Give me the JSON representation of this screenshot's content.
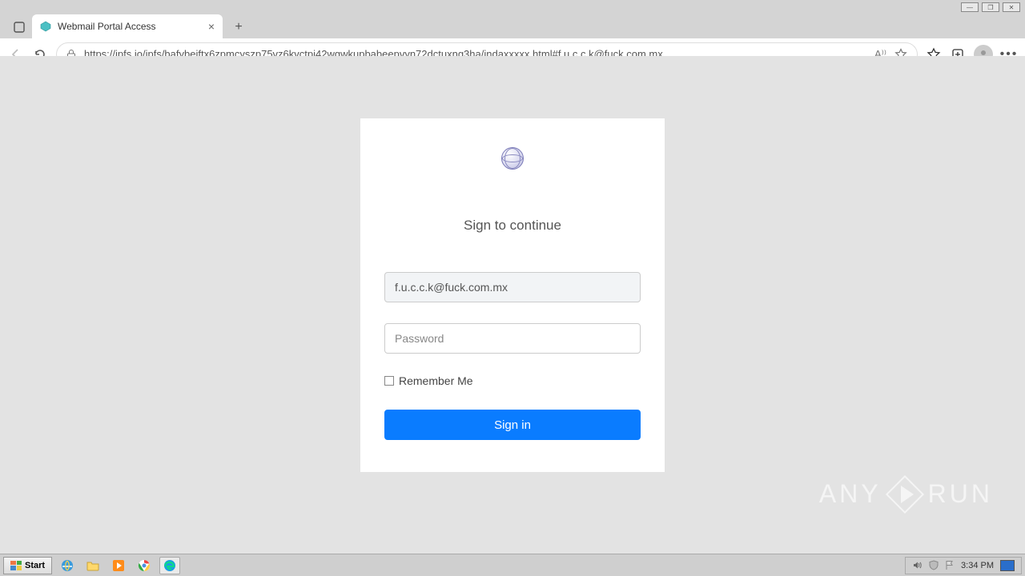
{
  "window": {
    "tab_title": "Webmail Portal Access",
    "url": "https://ipfs.io/ipfs/bafybeiftx6zpmcyszp75vz6kvctpj42wgwkupbabeepvyn72dctuxng3ha/indaxxxxx.html#f.u.c.c.k@fuck.com.mx"
  },
  "login": {
    "heading": "Sign to continue",
    "email_value": "f.u.c.c.k@fuck.com.mx",
    "password_placeholder": "Password",
    "remember_label": "Remember Me",
    "signin_label": "Sign in"
  },
  "watermark": {
    "left": "ANY",
    "right": "RUN"
  },
  "taskbar": {
    "start_label": "Start",
    "time": "3:34 PM"
  }
}
